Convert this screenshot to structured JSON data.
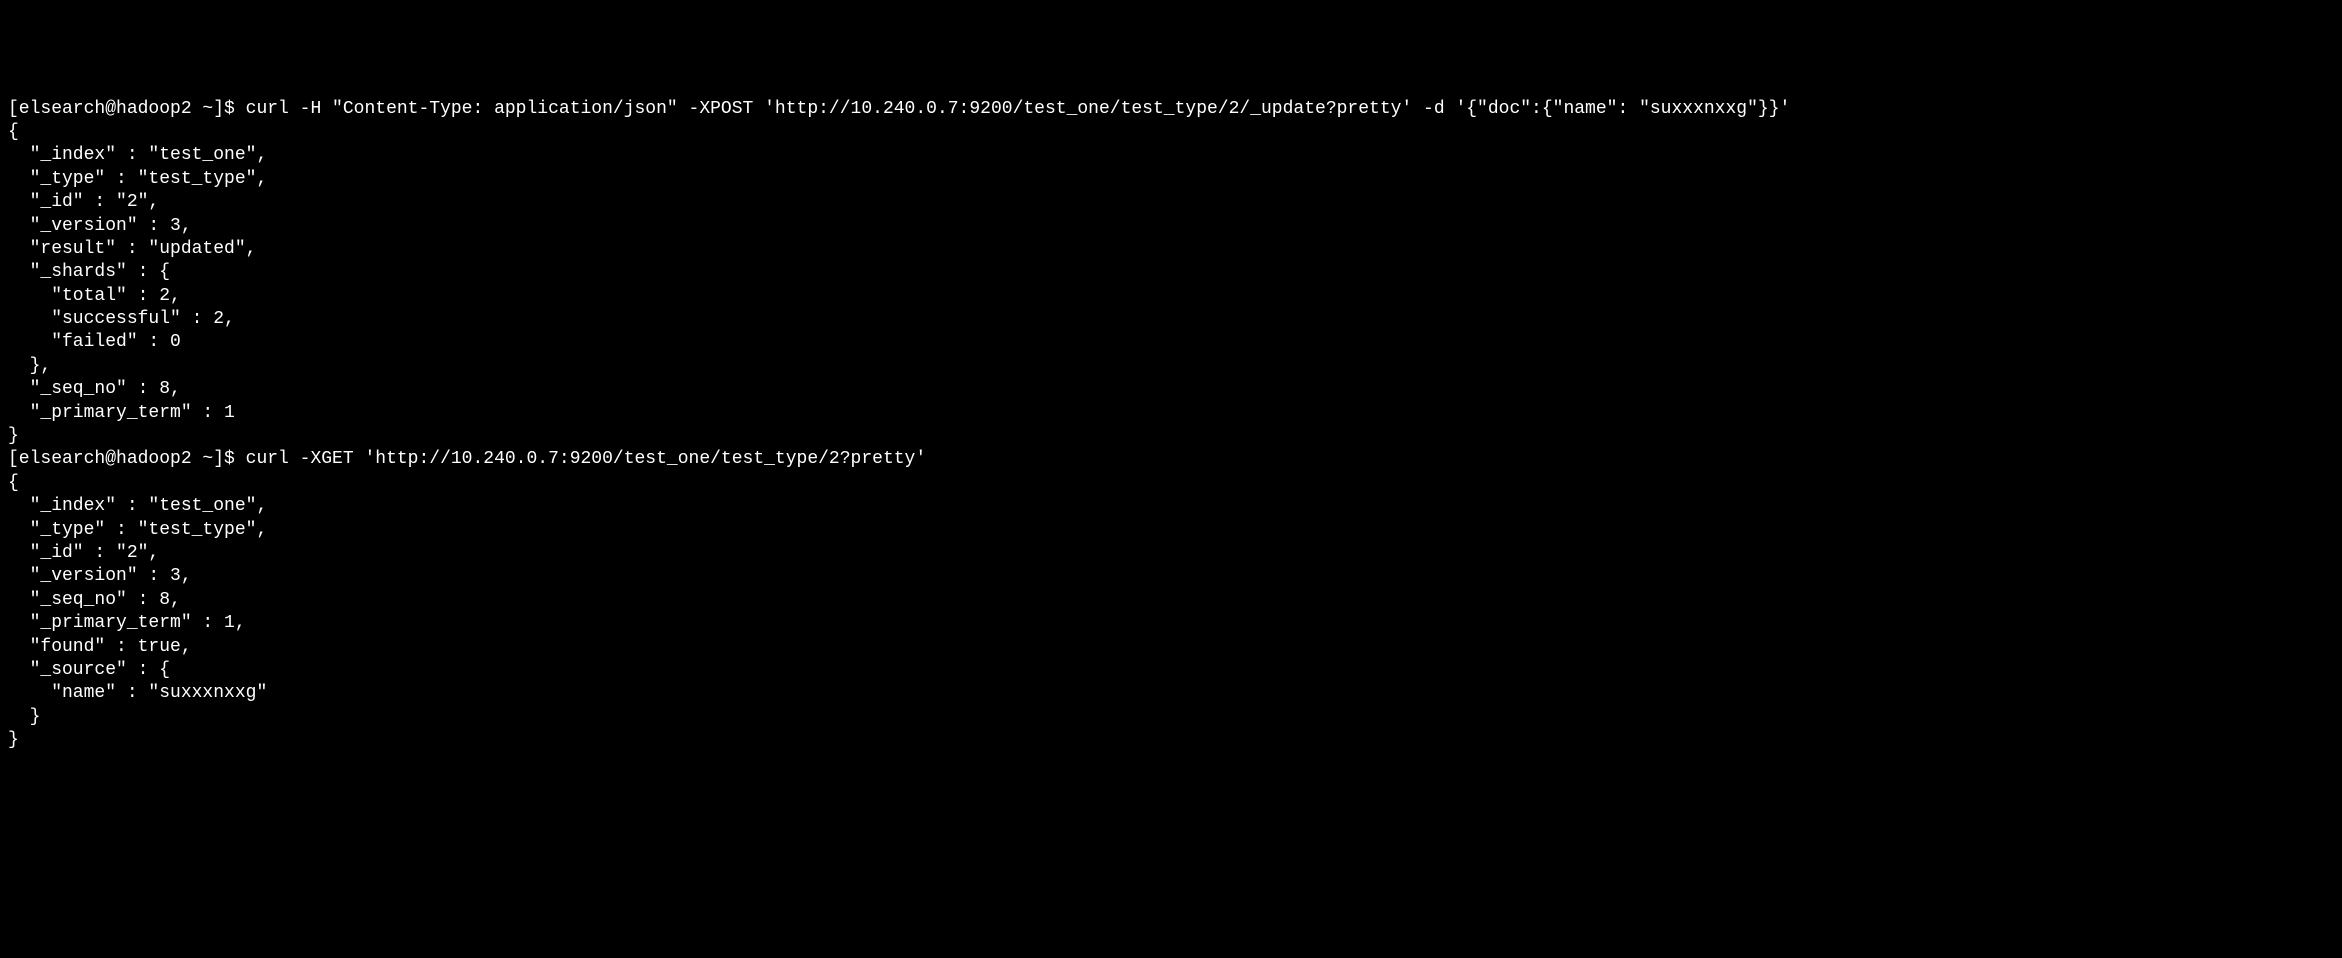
{
  "terminal": {
    "block1": {
      "prompt": "[elsearch@hadoop2 ~]$ ",
      "command": "curl -H \"Content-Type: application/json\" -XPOST 'http://10.240.0.7:9200/test_one/test_type/2/_update?pretty' -d '{\"doc\":{\"name\": \"suxxxnxxg\"}}'",
      "response": "{\n  \"_index\" : \"test_one\",\n  \"_type\" : \"test_type\",\n  \"_id\" : \"2\",\n  \"_version\" : 3,\n  \"result\" : \"updated\",\n  \"_shards\" : {\n    \"total\" : 2,\n    \"successful\" : 2,\n    \"failed\" : 0\n  },\n  \"_seq_no\" : 8,\n  \"_primary_term\" : 1\n}"
    },
    "block2": {
      "prompt": "[elsearch@hadoop2 ~]$ ",
      "command": "curl -XGET 'http://10.240.0.7:9200/test_one/test_type/2?pretty'",
      "response": "{\n  \"_index\" : \"test_one\",\n  \"_type\" : \"test_type\",\n  \"_id\" : \"2\",\n  \"_version\" : 3,\n  \"_seq_no\" : 8,\n  \"_primary_term\" : 1,\n  \"found\" : true,\n  \"_source\" : {\n    \"name\" : \"suxxxnxxg\"\n  }\n}"
    }
  }
}
